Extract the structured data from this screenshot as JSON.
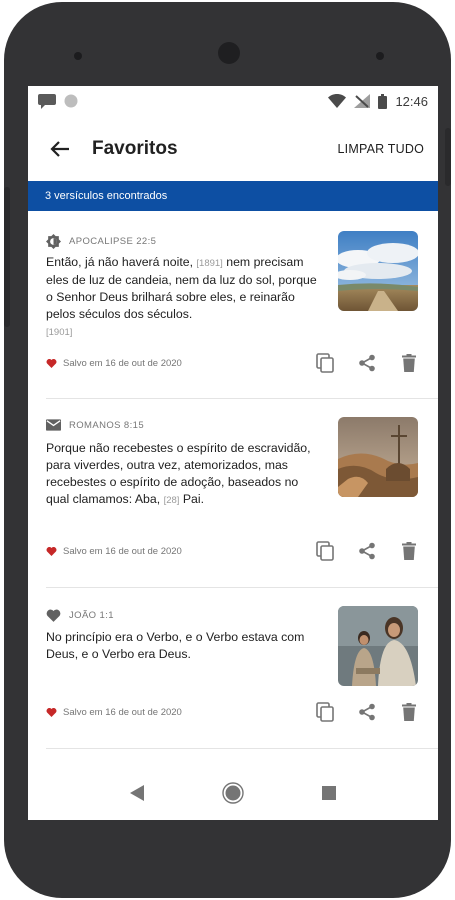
{
  "status_bar": {
    "time": "12:46",
    "icons": [
      "chat-icon",
      "circle-icon",
      "wifi-icon",
      "signal-icon",
      "battery-icon"
    ]
  },
  "app_bar": {
    "title": "Favoritos",
    "clear_label": "LIMPAR TUDO",
    "back_icon": "arrow-left-icon"
  },
  "banner": {
    "text": "3 versículos encontrados"
  },
  "colors": {
    "accent": "#0d4fa3",
    "heart": "#c62828",
    "text": "#212121"
  },
  "cards": [
    {
      "icon": "brightness-icon",
      "reference": "APOCALIPSE 22:5",
      "lines": [
        "Então, já não haverá noite, ",
        "nem precisam eles de luz de candeia, nem da luz do sol, porque o Senhor Deus brilhará sobre eles, e reinarão pelos séculos dos séculos."
      ],
      "refs": [
        "[1891]",
        "[1901]"
      ],
      "saved": "Salvo em 16 de out de 2020",
      "image": "sky-landscape-image"
    },
    {
      "icon": "mail-icon",
      "reference": "ROMANOS 8:15",
      "lines": [
        "Porque não recebestes o espírito de escravidão, para viverdes, outra vez, atemorizados, mas recebestes o espírito de adoção, baseados no qual clamamos: Aba, ",
        " Pai."
      ],
      "refs": [
        "[28]"
      ],
      "saved": "Salvo em 16 de out de 2020",
      "image": "desert-cross-image"
    },
    {
      "icon": "heart-icon",
      "reference": "JOÃO 1:1",
      "lines": [
        "No princípio era o Verbo, e o Verbo estava com Deus, e o Verbo era Deus."
      ],
      "refs": [],
      "saved": "Salvo em 16 de out de 2020",
      "image": "jesus-child-image"
    }
  ],
  "nav": [
    "back-triangle-icon",
    "home-circle-icon",
    "recents-square-icon"
  ]
}
